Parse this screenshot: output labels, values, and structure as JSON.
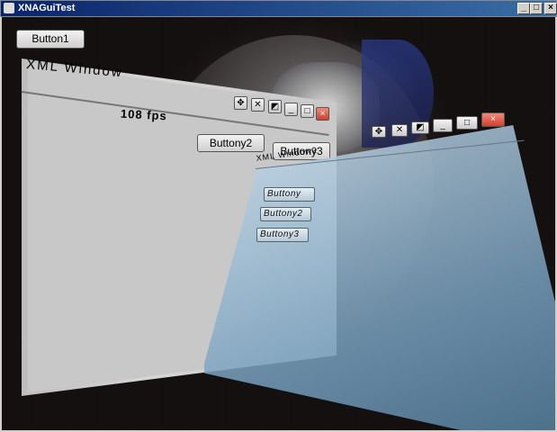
{
  "app": {
    "title": "XNAGuiTest",
    "min_glyph": "_",
    "max_glyph": "□",
    "close_glyph": "×"
  },
  "scene": {
    "button1_label": "Button1"
  },
  "xml_window": {
    "title": "XML Window",
    "fps_text": "108 fps",
    "buttony2_label": "Buttony2",
    "buttony3_label": "Buttony3",
    "controls": [
      "move-icon",
      "resize-icon",
      "restore-icon",
      "minimize-icon",
      "maximize-icon",
      "close-icon"
    ],
    "glyphs": {
      "move": "✥",
      "resize": "✕",
      "restore": "◩",
      "min": "_",
      "max": "□",
      "close": "×"
    }
  },
  "xml_window2": {
    "title": "XML Window2",
    "buttons": [
      "Buttony",
      "Buttony2",
      "Buttony3"
    ],
    "glyphs": {
      "move": "✥",
      "resize": "✕",
      "restore": "◩",
      "min": "_",
      "max": "□",
      "close": "×"
    }
  }
}
